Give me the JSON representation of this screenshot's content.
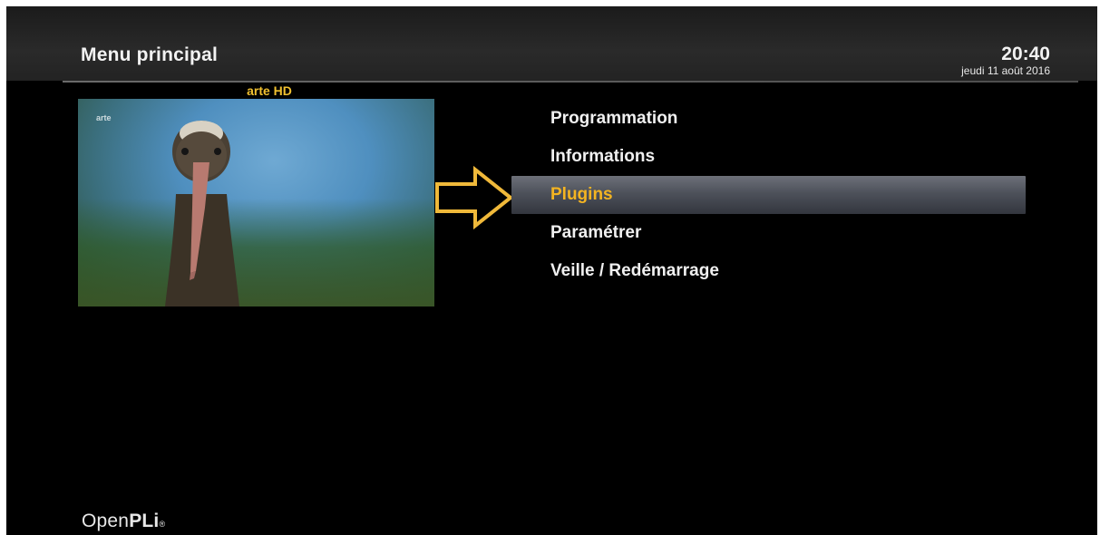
{
  "header": {
    "title": "Menu principal",
    "time": "20:40",
    "date": "jeudi 11 août 2016"
  },
  "preview": {
    "channel": "arte HD",
    "logo": "arte"
  },
  "menu": {
    "items": [
      {
        "label": "Programmation",
        "selected": false
      },
      {
        "label": "Informations",
        "selected": false
      },
      {
        "label": "Plugins",
        "selected": true
      },
      {
        "label": "Paramétrer",
        "selected": false
      },
      {
        "label": "Veille / Redémarrage",
        "selected": false
      }
    ]
  },
  "footer": {
    "brand_light": "Open",
    "brand_bold": "PLi",
    "brand_mark": "®"
  },
  "colors": {
    "background": "#000000",
    "selected_text": "#f4b421",
    "arrow": "#f0b93a",
    "channel_name": "#f0c030"
  },
  "icons": {
    "pointer": "arrow-right-icon"
  }
}
